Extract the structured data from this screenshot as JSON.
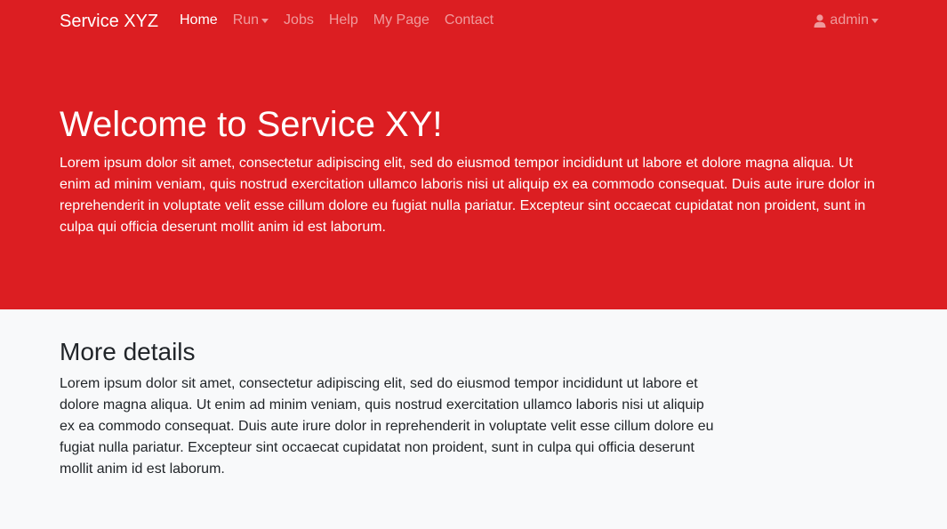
{
  "navbar": {
    "brand": "Service XYZ",
    "items": [
      {
        "label": "Home",
        "active": true,
        "dropdown": false
      },
      {
        "label": "Run",
        "active": false,
        "dropdown": true
      },
      {
        "label": "Jobs",
        "active": false,
        "dropdown": false
      },
      {
        "label": "Help",
        "active": false,
        "dropdown": false
      },
      {
        "label": "My Page",
        "active": false,
        "dropdown": false
      },
      {
        "label": "Contact",
        "active": false,
        "dropdown": false
      }
    ],
    "user": {
      "icon": "user-icon",
      "label": "admin"
    }
  },
  "hero": {
    "title": "Welcome to Service XY!",
    "text": "Lorem ipsum dolor sit amet, consectetur adipiscing elit, sed do eiusmod tempor incididunt ut labore et dolore magna aliqua. Ut enim ad minim veniam, quis nostrud exercitation ullamco laboris nisi ut aliquip ex ea commodo consequat. Duis aute irure dolor in reprehenderit in voluptate velit esse cillum dolore eu fugiat nulla pariatur. Excepteur sint occaecat cupidatat non proident, sunt in culpa qui officia deserunt mollit anim id est laborum."
  },
  "details": {
    "title": "More details",
    "text": "Lorem ipsum dolor sit amet, consectetur adipiscing elit, sed do eiusmod tempor incididunt ut labore et dolore magna aliqua. Ut enim ad minim veniam, quis nostrud exercitation ullamco laboris nisi ut aliquip ex ea commodo consequat. Duis aute irure dolor in reprehenderit in voluptate velit esse cillum dolore eu fugiat nulla pariatur. Excepteur sint occaecat cupidatat non proident, sunt in culpa qui officia deserunt mollit anim id est laborum."
  },
  "colors": {
    "primary": "#dc1e22",
    "background": "#f8f9fa",
    "text": "#212529"
  }
}
